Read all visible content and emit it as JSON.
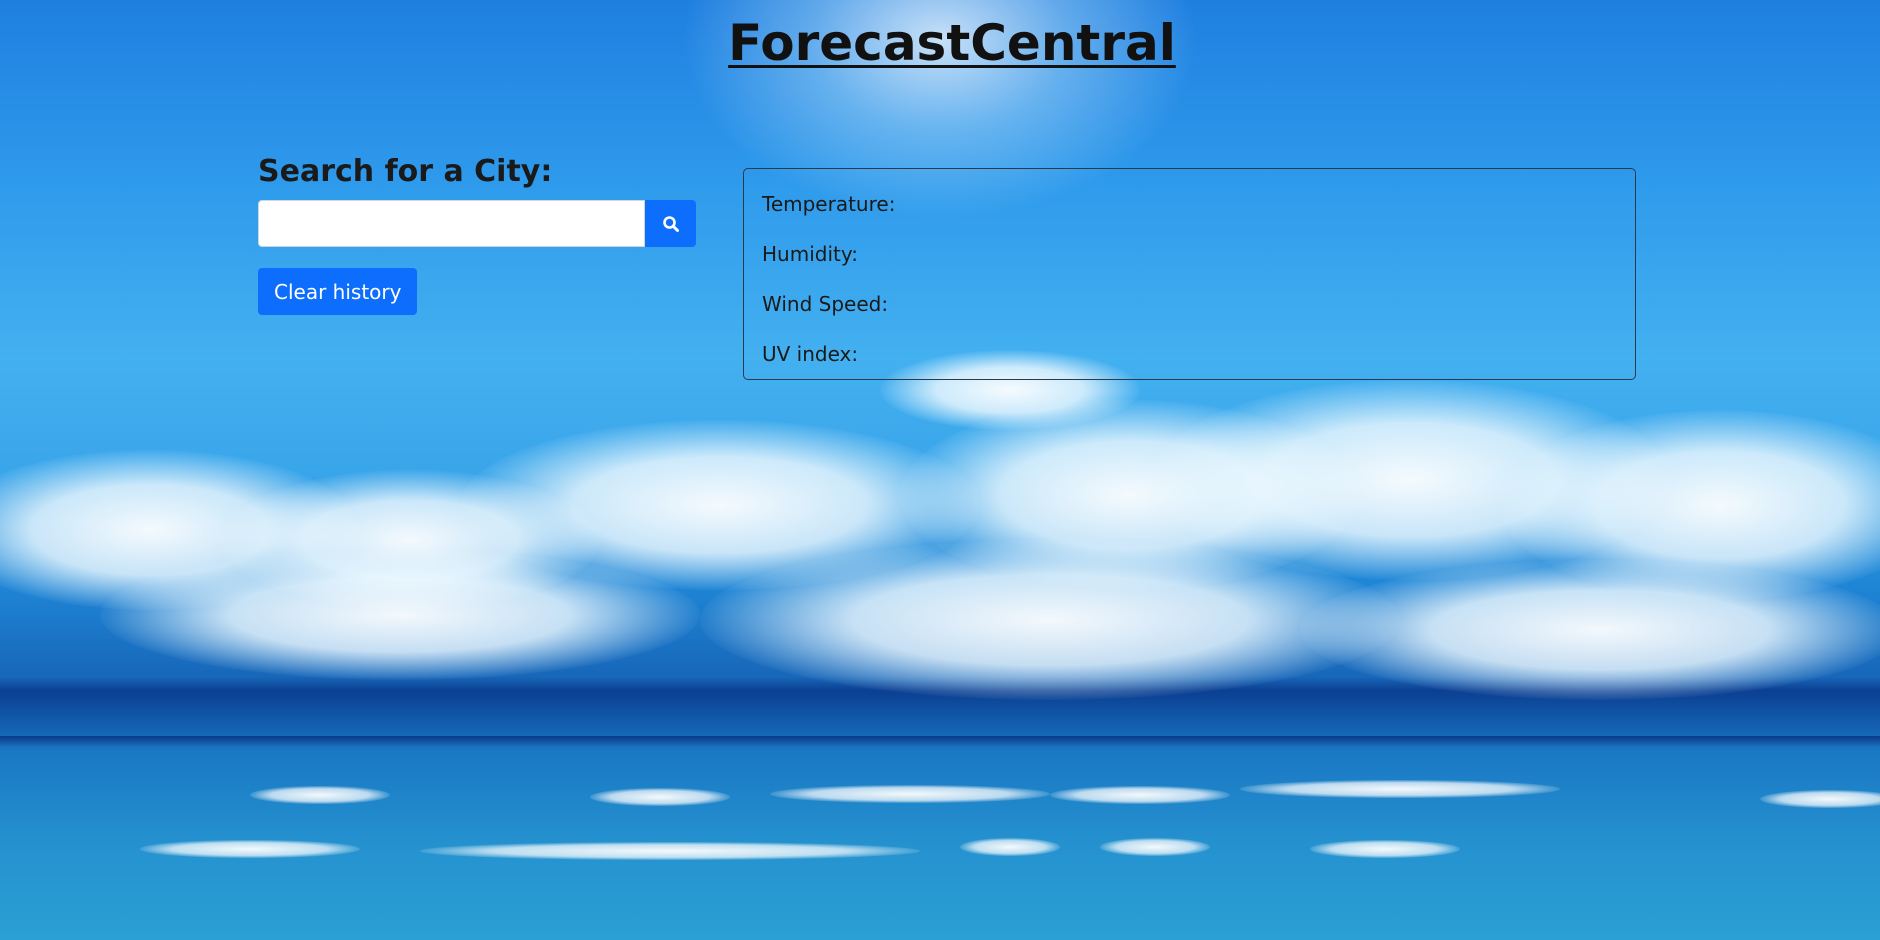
{
  "header": {
    "title": "ForecastCentral"
  },
  "search": {
    "heading": "Search for a City:",
    "input_value": "",
    "placeholder": "",
    "button_icon": "search-icon",
    "clear_label": "Clear history"
  },
  "weather": {
    "temperature_label": "Temperature:",
    "humidity_label": "Humidity:",
    "wind_label": "Wind Speed:",
    "uv_label": "UV index:"
  },
  "colors": {
    "accent": "#0d6efd",
    "text": "#1a1a1a",
    "card_border": "#2b3a4a"
  }
}
